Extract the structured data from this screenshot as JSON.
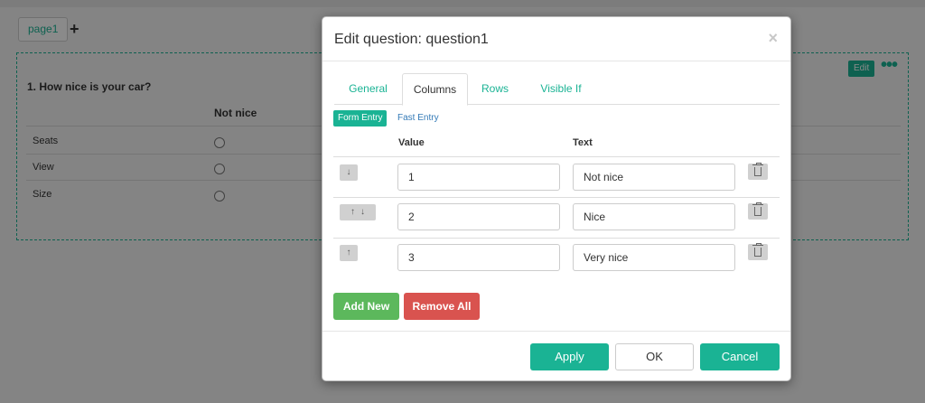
{
  "editor": {
    "page_tab": "page1",
    "add_page_icon": "plus-icon",
    "question_title": "1. How nice is your car?",
    "edit_label": "Edit",
    "more_icon": "ellipsis-icon",
    "column_header": "Not nice",
    "rows": [
      "Seats",
      "View",
      "Size"
    ]
  },
  "modal": {
    "title": "Edit question: question1",
    "close_label": "×",
    "tabs": [
      "General",
      "Columns",
      "Rows",
      "Visible If"
    ],
    "active_tab": "Columns",
    "entry_modes": {
      "form": "Form Entry",
      "fast": "Fast Entry"
    },
    "columns": {
      "value": "Value",
      "text": "Text"
    },
    "items": [
      {
        "value": "1",
        "text": "Not nice",
        "arrows": [
          "↓"
        ]
      },
      {
        "value": "2",
        "text": "Nice",
        "arrows": [
          "↑",
          "↓"
        ]
      },
      {
        "value": "3",
        "text": "Very nice",
        "arrows": [
          "↑"
        ]
      }
    ],
    "add_new_label": "Add New",
    "remove_all_label": "Remove All",
    "footer": {
      "apply": "Apply",
      "ok": "OK",
      "cancel": "Cancel"
    }
  },
  "colors": {
    "accent": "#1ab394",
    "add": "#5cb85c",
    "remove": "#d9534f",
    "link": "#337ab7"
  }
}
